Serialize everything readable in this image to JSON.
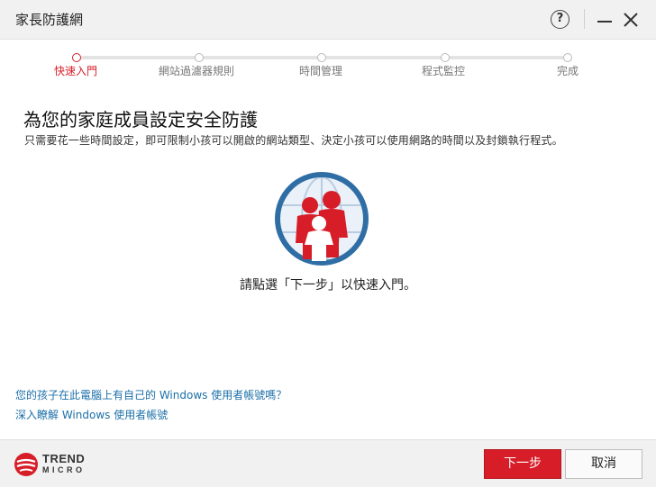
{
  "window": {
    "title": "家長防護網",
    "help_symbol": "?"
  },
  "steps": [
    {
      "label": "快速入門",
      "active": true
    },
    {
      "label": "網站過濾器規則",
      "active": false
    },
    {
      "label": "時間管理",
      "active": false
    },
    {
      "label": "程式監控",
      "active": false
    },
    {
      "label": "完成",
      "active": false
    }
  ],
  "main": {
    "heading": "為您的家庭成員設定安全防護",
    "subtitle": "只需要花一些時間設定，即可限制小孩可以開啟的網站類型、決定小孩可以使用網路的時間以及封鎖執行程式。",
    "hint": "請點選「下一步」以快速入門。"
  },
  "links": {
    "own_account": "您的孩子在此電腦上有自己的 Windows 使用者帳號嗎？",
    "learn_more": "深入瞭解 Windows 使用者帳號"
  },
  "footer": {
    "logo_line1": "TREND",
    "logo_line2": "MICRO",
    "next_label": "下一步",
    "cancel_label": "取消"
  },
  "colors": {
    "accent": "#d71e28",
    "link": "#1b6fa8",
    "icon_blue": "#2f6ea5"
  },
  "icons": {
    "help": "help-icon",
    "minimize": "minimize-icon",
    "close": "close-icon",
    "family": "family-globe-icon",
    "logo": "trend-micro-logo"
  }
}
